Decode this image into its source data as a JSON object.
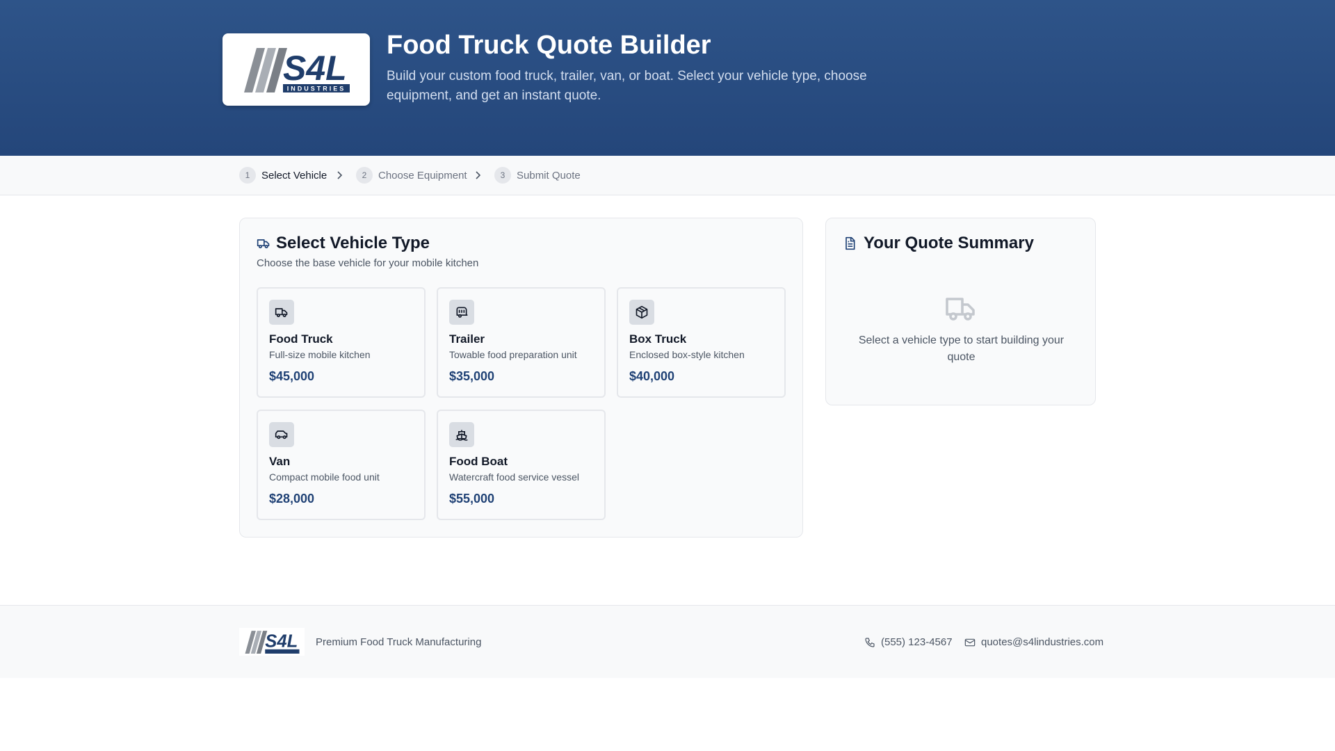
{
  "brand": {
    "logo_text": "S4L",
    "logo_subtext": "INDUSTRIES",
    "primary_color": "#24467a",
    "accent_color": "#1f4175"
  },
  "header": {
    "title": "Food Truck Quote Builder",
    "subtitle": "Build your custom food truck, trailer, van, or boat. Select your vehicle type, choose equipment, and get an instant quote."
  },
  "steps": [
    {
      "number": "1",
      "label": "Select Vehicle",
      "active": true
    },
    {
      "number": "2",
      "label": "Choose Equipment",
      "active": false
    },
    {
      "number": "3",
      "label": "Submit Quote",
      "active": false
    }
  ],
  "vehicle_panel": {
    "title": "Select Vehicle Type",
    "description": "Choose the base vehicle for your mobile kitchen",
    "icon": "truck-icon",
    "vehicles": [
      {
        "name": "Food Truck",
        "description": "Full-size mobile kitchen",
        "price": "$45,000",
        "icon": "truck-icon"
      },
      {
        "name": "Trailer",
        "description": "Towable food preparation unit",
        "price": "$35,000",
        "icon": "caravan-icon"
      },
      {
        "name": "Box Truck",
        "description": "Enclosed box-style kitchen",
        "price": "$40,000",
        "icon": "package-icon"
      },
      {
        "name": "Van",
        "description": "Compact mobile food unit",
        "price": "$28,000",
        "icon": "van-icon"
      },
      {
        "name": "Food Boat",
        "description": "Watercraft food service vessel",
        "price": "$55,000",
        "icon": "ship-icon"
      }
    ]
  },
  "summary": {
    "title": "Your Quote Summary",
    "icon": "document-icon",
    "empty_message": "Select a vehicle type to start building your quote",
    "empty_icon": "truck-icon"
  },
  "footer": {
    "tagline": "Premium Food Truck Manufacturing",
    "phone": "(555) 123-4567",
    "email": "quotes@s4lindustries.com"
  }
}
